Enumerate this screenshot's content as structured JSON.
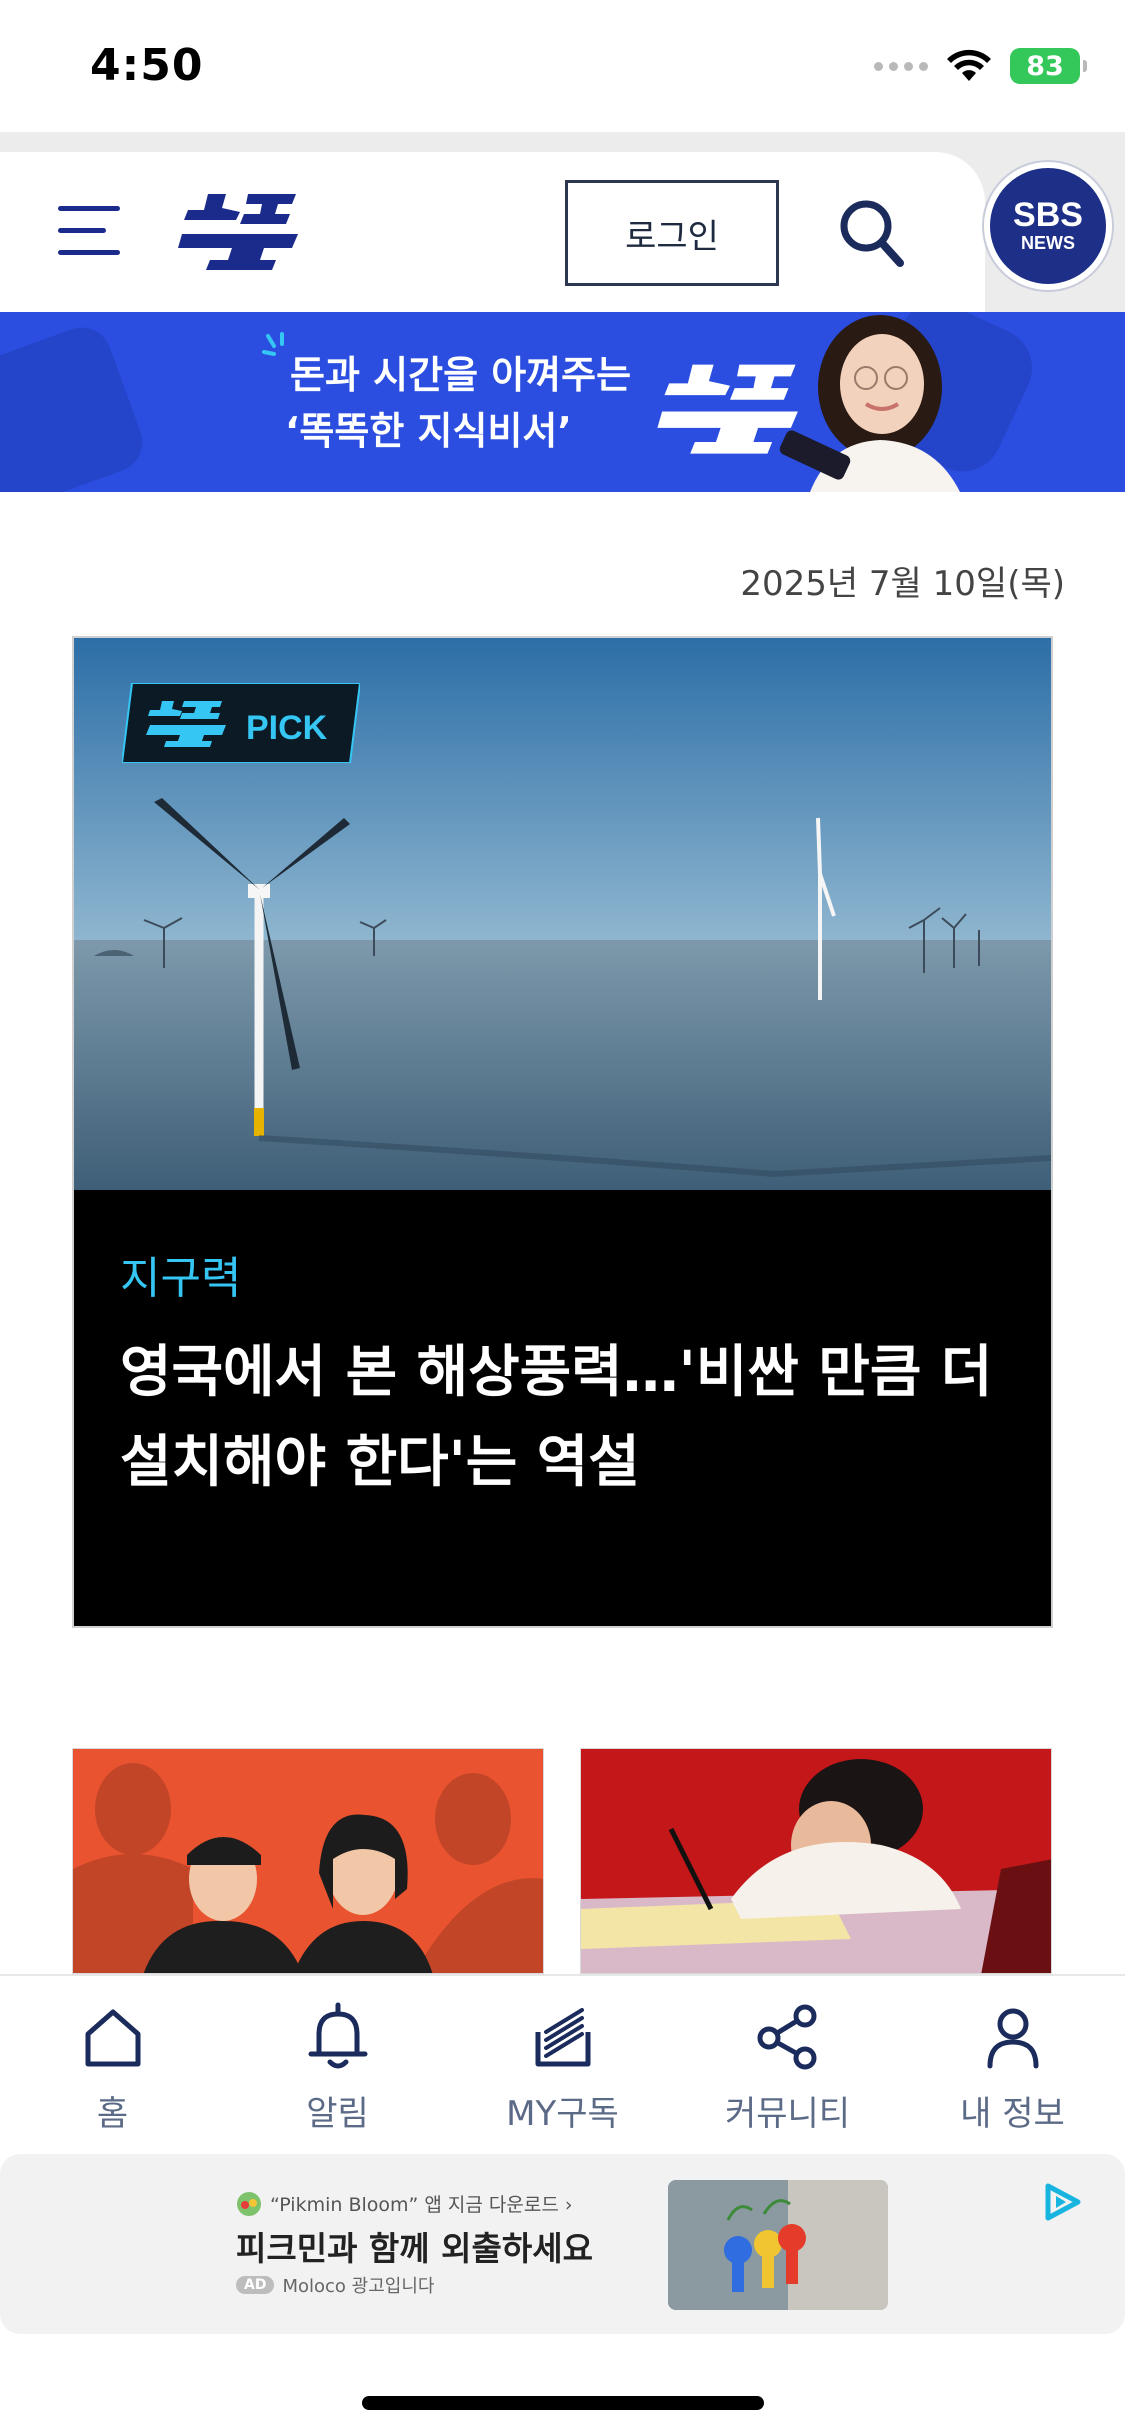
{
  "status": {
    "time": "4:50",
    "battery": "83"
  },
  "header": {
    "login_label": "로그인",
    "sbs_label": "SBS",
    "news_label": "NEWS"
  },
  "banner": {
    "line1": "돈과 시간을 아껴주는",
    "line2": "‘똑똑한 지식비서’"
  },
  "date": "2025년 7월 10일(목)",
  "feature": {
    "badge": "PICK",
    "category": "지구력",
    "title": "영국에서 본 해상풍력…'비싼 만큼 더 설치해야 한다'는 역설"
  },
  "nav": {
    "home": "홈",
    "alerts": "알림",
    "subscribe": "MY구독",
    "community": "커뮤니티",
    "profile": "내 정보"
  },
  "ad": {
    "top": "“Pikmin Bloom” 앱 지금 다운로드 ›",
    "title": "피크민과 함께 외출하세요",
    "tag": "AD",
    "sub": "Moloco 광고입니다"
  },
  "colors": {
    "brand": "#1a2b8c",
    "accent": "#35c6f4",
    "banner": "#2b4ee0"
  }
}
